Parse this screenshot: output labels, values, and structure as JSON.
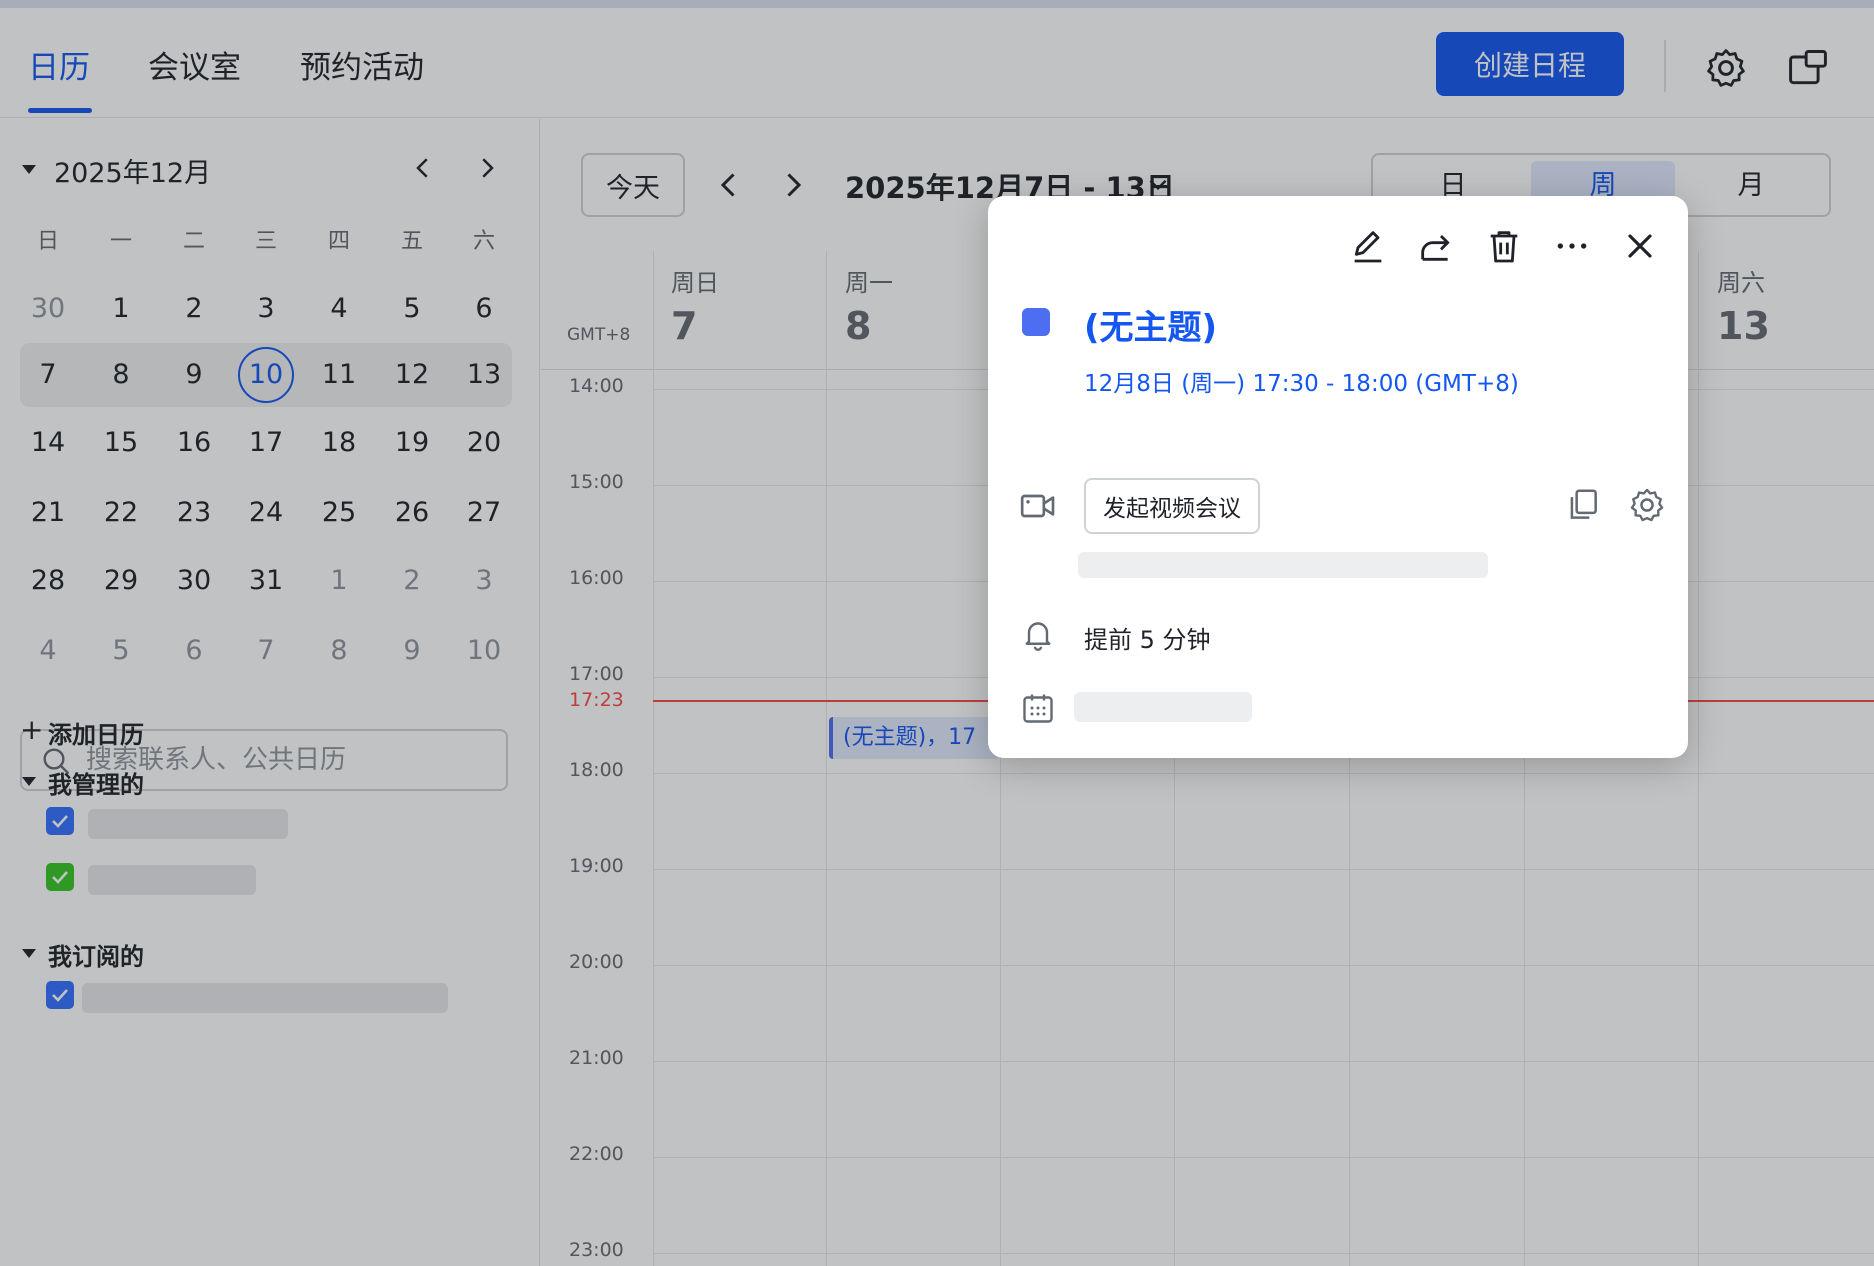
{
  "header": {
    "tabs": [
      {
        "label": "日历",
        "active": true
      },
      {
        "label": "会议室",
        "active": false
      },
      {
        "label": "预约活动",
        "active": false
      }
    ],
    "create_label": "创建日程",
    "icons": [
      "gear-icon",
      "window-icon"
    ]
  },
  "mini_calendar": {
    "month_title": "2025年12月",
    "weekdays": [
      "日",
      "一",
      "二",
      "三",
      "四",
      "五",
      "六"
    ],
    "weeks": [
      [
        "30",
        "1",
        "2",
        "3",
        "4",
        "5",
        "6"
      ],
      [
        "7",
        "8",
        "9",
        "10",
        "11",
        "12",
        "13"
      ],
      [
        "14",
        "15",
        "16",
        "17",
        "18",
        "19",
        "20"
      ],
      [
        "21",
        "22",
        "23",
        "24",
        "25",
        "26",
        "27"
      ],
      [
        "28",
        "29",
        "30",
        "31",
        "1",
        "2",
        "3"
      ],
      [
        "4",
        "5",
        "6",
        "7",
        "8",
        "9",
        "10"
      ]
    ],
    "today": "10"
  },
  "sidebar": {
    "search_placeholder": "搜索联系人、公共日历",
    "add_calendar": "添加日历",
    "managed_title": "我管理的",
    "subscribed_title": "我订阅的"
  },
  "toolbar": {
    "today_label": "今天",
    "range_title": "2025年12月7日 - 13日",
    "views": [
      {
        "label": "日",
        "active": false
      },
      {
        "label": "周",
        "active": true
      },
      {
        "label": "月",
        "active": false
      }
    ]
  },
  "week": {
    "timezone": "GMT+8",
    "days": [
      {
        "weekday": "周日",
        "date": "7"
      },
      {
        "weekday": "周一",
        "date": "8"
      },
      {
        "weekday": "周六",
        "date": "13"
      }
    ],
    "hours": [
      "14:00",
      "15:00",
      "16:00",
      "17:00",
      "18:00",
      "19:00",
      "20:00",
      "21:00",
      "22:00",
      "23:00"
    ],
    "now_label": "17:23",
    "event_chip": "(无主题)，17"
  },
  "popup": {
    "title": "(无主题)",
    "time": "12月8日 (周一) 17:30 - 18:00 (GMT+8)",
    "video_button": "发起视频会议",
    "reminder": "提前 5 分钟",
    "colors": {
      "event": "#4e6ef2",
      "accent": "#1456f0"
    }
  }
}
